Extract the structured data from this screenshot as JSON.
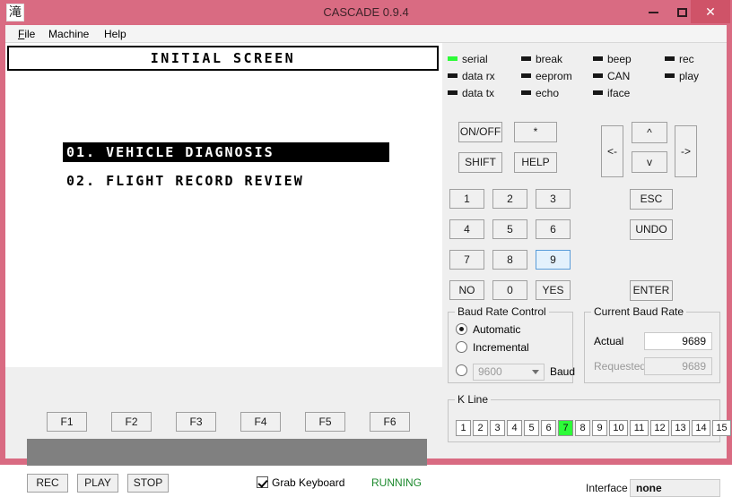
{
  "window": {
    "title": "CASCADE 0.9.4",
    "icon_glyph": "滝",
    "icon_name": "app-icon-waterfall",
    "minimize_label": "",
    "maximize_label": "",
    "close_label": "✕",
    "titlebar_color": "#d96b82",
    "close_button_color": "#cf5368"
  },
  "menubar": {
    "items": [
      {
        "label": "File",
        "accel": "F"
      },
      {
        "label": "Machine",
        "accel": "M"
      },
      {
        "label": "Help",
        "accel": "H"
      }
    ]
  },
  "lcd": {
    "header": "INITIAL SCREEN",
    "rows": [
      {
        "text": "01. VEHICLE DIAGNOSIS",
        "selected": true
      },
      {
        "text": "02. FLIGHT RECORD REVIEW",
        "selected": false
      }
    ]
  },
  "function_keys": {
    "labels": [
      "F1",
      "F2",
      "F3",
      "F4",
      "F5",
      "F6"
    ]
  },
  "transport": {
    "rec_label": "REC",
    "play_label": "PLAY",
    "stop_label": "STOP",
    "grab_keyboard_label": "Grab Keyboard",
    "grab_keyboard_checked": true,
    "status_text": "RUNNING",
    "status_color": "#1d8a2e"
  },
  "leds": {
    "on_color": "#2dfb38",
    "off_color": "#171717",
    "items": [
      {
        "label": "serial",
        "on": true
      },
      {
        "label": "data rx",
        "on": false
      },
      {
        "label": "data tx",
        "on": false
      },
      {
        "label": "break",
        "on": false
      },
      {
        "label": "eeprom",
        "on": false
      },
      {
        "label": "echo",
        "on": false
      },
      {
        "label": "beep",
        "on": false
      },
      {
        "label": "CAN",
        "on": false
      },
      {
        "label": "iface",
        "on": false
      },
      {
        "label": "rec",
        "on": false
      },
      {
        "label": "play",
        "on": false
      }
    ]
  },
  "keypad": {
    "onoff_label": "ON/OFF",
    "star_label": "*",
    "shift_label": "SHIFT",
    "help_label": "HELP",
    "digits": [
      "1",
      "2",
      "3",
      "4",
      "5",
      "6",
      "7",
      "8",
      "9"
    ],
    "focused_digit": "9",
    "no_label": "NO",
    "zero_label": "0",
    "yes_label": "YES"
  },
  "navpad": {
    "left_label": "<-",
    "up_label": "^",
    "down_label": "v",
    "right_label": "->",
    "esc_label": "ESC",
    "undo_label": "UNDO",
    "enter_label": "ENTER"
  },
  "baud_control": {
    "title": "Baud Rate Control",
    "options": [
      {
        "label": "Automatic",
        "selected": true
      },
      {
        "label": "Incremental",
        "selected": false
      },
      {
        "label": "",
        "selected": false
      }
    ],
    "select_value": "9600",
    "select_enabled": false,
    "unit_label": "Baud"
  },
  "current_baud": {
    "title": "Current Baud Rate",
    "actual_label": "Actual",
    "actual_value": "9689",
    "requested_label": "Requested",
    "requested_value": "9689",
    "requested_enabled": false
  },
  "kline": {
    "title": "K Line",
    "cells": [
      "1",
      "2",
      "3",
      "4",
      "5",
      "6",
      "7",
      "8",
      "9",
      "10",
      "11",
      "12",
      "13",
      "14",
      "15"
    ],
    "active_cell": "7",
    "active_color": "#2dfb38"
  },
  "interface": {
    "label": "Interface",
    "value": "none"
  }
}
